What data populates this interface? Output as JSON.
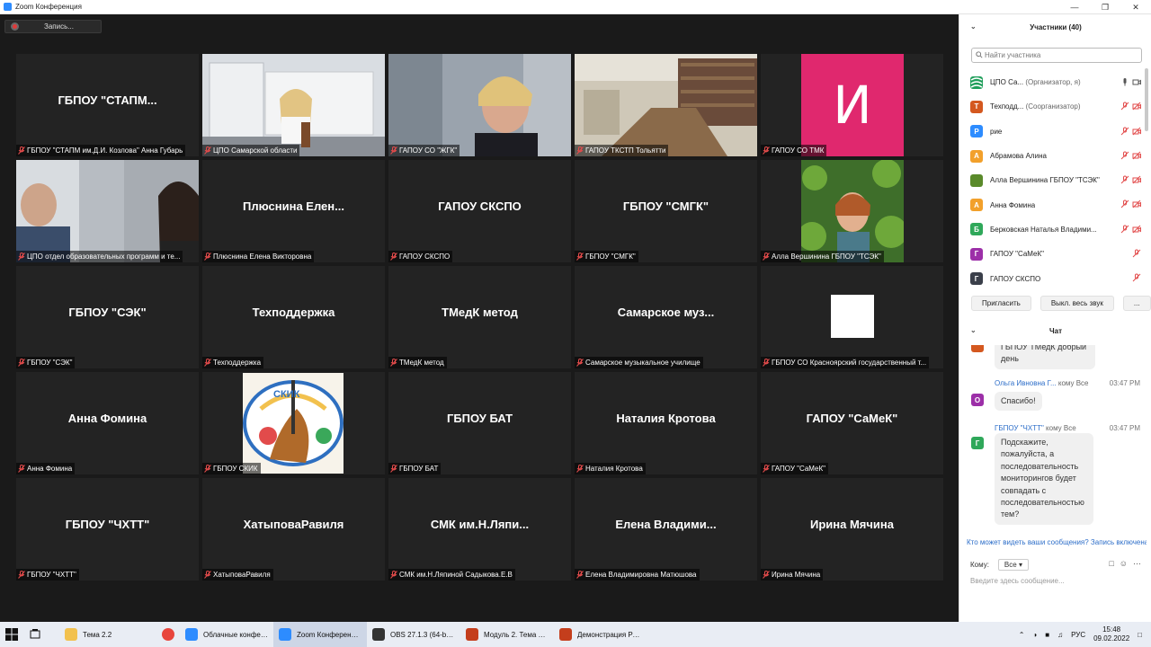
{
  "window": {
    "title": "Zoom Конференция"
  },
  "recording": {
    "label": "Запись..."
  },
  "tiles": [
    {
      "center": "ГБПОУ \"СТАПМ...",
      "label": "ГБПОУ \"СТАПМ им.Д.И. Козлова\" Анна Губарь",
      "kind": "name"
    },
    {
      "center": "",
      "label": "ЦПО Самарской области",
      "kind": "video-office",
      "active": true
    },
    {
      "center": "",
      "label": "ГАПОУ СО \"ЖГК\"",
      "kind": "video-woman"
    },
    {
      "center": "",
      "label": "ГАПОУ ТКСТП Тольятти",
      "kind": "video-library"
    },
    {
      "center": "",
      "label": "ГАПОУ СО ТМК",
      "kind": "avatar-i",
      "avatar_letter": "И",
      "avatar_color": "#e0286e"
    },
    {
      "center": "",
      "label": "ЦПО отдел образовательных программ и те...",
      "kind": "video-two"
    },
    {
      "center": "Плюснина Елен...",
      "label": "Плюснина Елена Викторовна",
      "kind": "name"
    },
    {
      "center": "ГАПОУ СКСПО",
      "label": "ГАПОУ СКСПО",
      "kind": "name"
    },
    {
      "center": "ГБПОУ \"СМГК\"",
      "label": "ГБПОУ \"СМГК\"",
      "kind": "name"
    },
    {
      "center": "",
      "label": "Алла Вершинина ГБПОУ \"ТСЭК\"",
      "kind": "video-green"
    },
    {
      "center": "ГБПОУ \"СЭК\"",
      "label": "ГБПОУ \"СЭК\"",
      "kind": "name"
    },
    {
      "center": "Техподдержка",
      "label": "Техподдержка",
      "kind": "name"
    },
    {
      "center": "ТМедК метод",
      "label": "ТМедК метод",
      "kind": "name"
    },
    {
      "center": "Самарское муз...",
      "label": "Самарское музыкальное училище",
      "kind": "name"
    },
    {
      "center": "",
      "label": "ГБПОУ СО Красноярский государственный т...",
      "kind": "white-box"
    },
    {
      "center": "Анна Фомина",
      "label": "Анна Фомина",
      "kind": "name"
    },
    {
      "center": "",
      "label": "ГБПОУ СКИК",
      "kind": "logo-skik",
      "logo_text": "СКИК"
    },
    {
      "center": "ГБПОУ БАТ",
      "label": "ГБПОУ БАТ",
      "kind": "name"
    },
    {
      "center": "Наталия Кротова",
      "label": "Наталия Кротова",
      "kind": "name"
    },
    {
      "center": "ГАПОУ \"СаМеК\"",
      "label": "ГАПОУ \"СаМеК\"",
      "kind": "name"
    },
    {
      "center": "ГБПОУ \"ЧХТТ\"",
      "label": "ГБПОУ \"ЧХТТ\"",
      "kind": "name"
    },
    {
      "center": "ХатыповаРавиля",
      "label": "ХатыповаРавиля",
      "kind": "name"
    },
    {
      "center": "СМК им.Н.Ляпи...",
      "label": "СМК им.Н.Ляпиной Садыкова.Е.В",
      "kind": "name"
    },
    {
      "center": "Елена Владими...",
      "label": "Елена Владимировна Матюшова",
      "kind": "name"
    },
    {
      "center": "Ирина Мячина",
      "label": "Ирина Мячина",
      "kind": "name"
    }
  ],
  "participants": {
    "title": "Участники (40)",
    "search_placeholder": "Найти участника",
    "items": [
      {
        "avatar": "",
        "color": "#1f9e5a",
        "name": "ЦПО Са...",
        "role": "(Организатор, я)",
        "icon": "logo-icon"
      },
      {
        "avatar": "Т",
        "color": "#d4581f",
        "name": "Техподд...",
        "role": "(Соорганизатор)",
        "icon": ""
      },
      {
        "avatar": "Р",
        "color": "#2d8cff",
        "name": "рие",
        "role": "",
        "icon": ""
      },
      {
        "avatar": "А",
        "color": "#f2a02b",
        "name": "Абрамова Алина",
        "role": "",
        "icon": ""
      },
      {
        "avatar": "",
        "color": "#5a8a2a",
        "name": "Алла Вершинина ГБПОУ \"ТСЭК\"",
        "role": "",
        "icon": "photo-icon"
      },
      {
        "avatar": "А",
        "color": "#f2a02b",
        "name": "Анна Фомина",
        "role": "",
        "icon": ""
      },
      {
        "avatar": "Б",
        "color": "#2fa85a",
        "name": "Берковская Наталья Владими...",
        "role": "",
        "icon": ""
      },
      {
        "avatar": "Г",
        "color": "#9c2fa8",
        "name": "ГАПОУ \"СаМеК\"",
        "role": "",
        "icon": ""
      },
      {
        "avatar": "Г",
        "color": "#3a3f4a",
        "name": "ГАПОУ СКСПО",
        "role": "",
        "icon": ""
      }
    ],
    "invite_label": "Пригласить",
    "mute_all_label": "Выкл. весь звук",
    "more_label": "..."
  },
  "chat": {
    "title": "Чат",
    "messages": [
      {
        "sender": "",
        "to": "",
        "time": "",
        "avatar": "",
        "color": "#d4581f",
        "text": "ГБПОУ ТМедК добрый день"
      },
      {
        "sender": "Ольга Ивновна Г...",
        "to": "кому Все",
        "time": "03:47 PM",
        "avatar": "О",
        "color": "#9c2fa8",
        "text": "Спасибо!"
      },
      {
        "sender": "ГБПОУ \"ЧХТТ\"",
        "to": "кому Все",
        "time": "03:47 PM",
        "avatar": "Г",
        "color": "#2fa85a",
        "text": "Подскажите, пожалуйста, а последовательность мониторингов будет совпадать с последовательностью тем?"
      }
    ],
    "notice": "Кто может видеть ваши сообщения? Запись включена",
    "to_label": "Кому:",
    "to_value": "Все",
    "input_placeholder": "Введите здесь сообщение..."
  },
  "taskbar": {
    "items": [
      {
        "label": "Тема 2.2",
        "color": "#f2c14e"
      },
      {
        "label": "",
        "color": "#e8453c"
      },
      {
        "label": "Облачные конфер...",
        "color": "#2d8cff"
      },
      {
        "label": "Zoom Конференция",
        "color": "#2d8cff",
        "active": true
      },
      {
        "label": "OBS 27.1.3 (64-bit, ...",
        "color": "#333333"
      },
      {
        "label": "Модуль 2. Тема 2.2...",
        "color": "#c43e1c"
      },
      {
        "label": "Демонстрация Ро...",
        "color": "#c43e1c"
      }
    ],
    "lang": "РУС",
    "time": "15:48",
    "date": "09.02.2022"
  }
}
